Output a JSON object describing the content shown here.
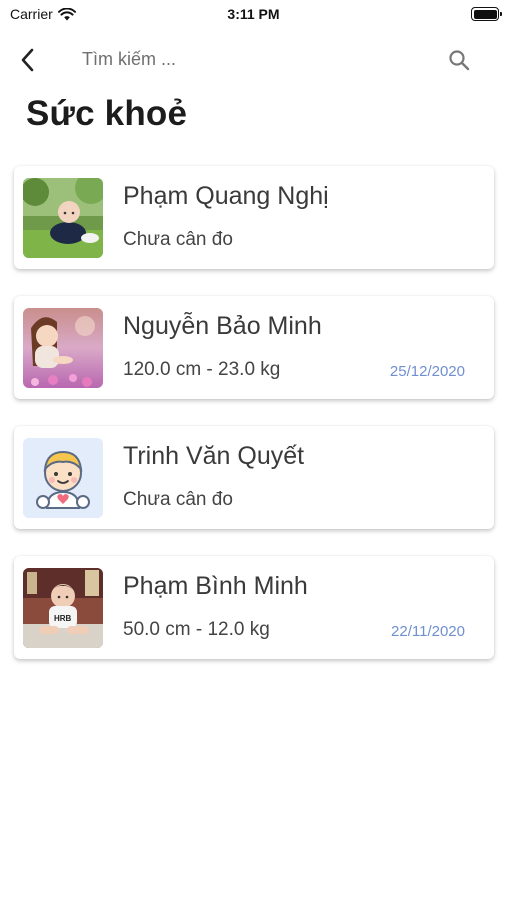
{
  "status_bar": {
    "carrier": "Carrier",
    "time": "3:11 PM",
    "battery_level": 1.0
  },
  "nav": {
    "back_icon": "chevron-left-icon",
    "search_placeholder": "Tìm kiếm ...",
    "search_value": "",
    "search_icon": "search-icon"
  },
  "title": "Sức khoẻ",
  "children": [
    {
      "name": "Phạm Quang Nghị",
      "measurement": "Chưa cân đo",
      "date": "",
      "avatar": "photo-boy-on-grass"
    },
    {
      "name": "Nguyễn Bảo Minh",
      "measurement": "120.0 cm - 23.0 kg",
      "date": "25/12/2020",
      "avatar": "photo-girl-in-flowers"
    },
    {
      "name": "Trinh Văn Quyết",
      "measurement": "Chưa cân đo",
      "date": "",
      "avatar": "baby-illustration-icon"
    },
    {
      "name": "Phạm Bình Minh",
      "measurement": "50.0 cm - 12.0 kg",
      "date": "22/11/2020",
      "avatar": "photo-baby-sitting"
    }
  ],
  "colors": {
    "date_accent": "#6f8fd0",
    "title": "#1c1c1c",
    "avatar_placeholder_bg": "#e3ecfb"
  }
}
